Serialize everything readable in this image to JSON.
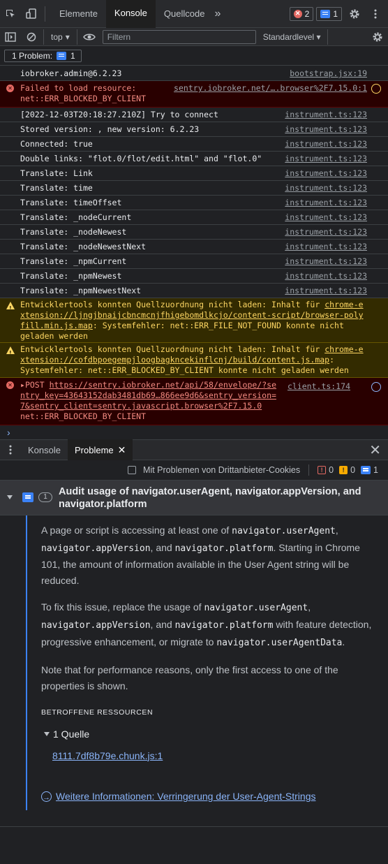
{
  "tabs": {
    "items": [
      {
        "label": "Elemente"
      },
      {
        "label": "Konsole",
        "active": true
      },
      {
        "label": "Quellcode"
      }
    ],
    "more": "»",
    "error_count": "2",
    "issue_count": "1"
  },
  "toolbar": {
    "context": "top",
    "filter_placeholder": "Filtern",
    "level": "Standardlevel"
  },
  "problems_button": {
    "label": "1 Problem:",
    "count": "1"
  },
  "console_rows": [
    {
      "type": "log",
      "text": "iobroker.admin@6.2.23",
      "source": "bootstrap.jsx:19"
    },
    {
      "type": "error",
      "line1": "Failed to load resource:",
      "line2": "net::ERR_BLOCKED_BY_CLIENT",
      "source": "sentry.iobroker.net/….browser%2F7.15.0:1"
    },
    {
      "type": "log",
      "text": "[2022-12-03T20:18:27.210Z] Try to connect",
      "source": "instrument.ts:123"
    },
    {
      "type": "log",
      "text": "Stored version: , new version: 6.2.23",
      "source": "instrument.ts:123"
    },
    {
      "type": "log",
      "text": "Connected: true",
      "source": "instrument.ts:123"
    },
    {
      "type": "log",
      "text": "Double links: \"flot.0/flot/edit.html\" and \"flot.0\"",
      "source": "instrument.ts:123"
    },
    {
      "type": "log",
      "text": "Translate: Link",
      "source": "instrument.ts:123"
    },
    {
      "type": "log",
      "text": "Translate: time",
      "source": "instrument.ts:123"
    },
    {
      "type": "log",
      "text": "Translate: timeOffset",
      "source": "instrument.ts:123"
    },
    {
      "type": "log",
      "text": "Translate: _nodeCurrent",
      "source": "instrument.ts:123"
    },
    {
      "type": "log",
      "text": "Translate: _nodeNewest",
      "source": "instrument.ts:123"
    },
    {
      "type": "log",
      "text": "Translate: _nodeNewestNext",
      "source": "instrument.ts:123"
    },
    {
      "type": "log",
      "text": "Translate: _npmCurrent",
      "source": "instrument.ts:123"
    },
    {
      "type": "log",
      "text": "Translate: _npmNewest",
      "source": "instrument.ts:123"
    },
    {
      "type": "log",
      "text": "Translate: _npmNewestNext",
      "source": "instrument.ts:123"
    }
  ],
  "warnings": [
    {
      "prefix": "Entwicklertools konnten Quellzuordnung nicht laden: Inhalt für ",
      "link_a": "chrome-e",
      "link_b": "xtension://ljngjbnaijcbncmcnjfhigebomdlkcjo/content-script/browser-poly",
      "link_c": "fill.min.js.map",
      "suffix_c": ": Systemfehler: net::ERR_FILE_NOT_FOUND konnte nicht",
      "line4": "geladen werden"
    },
    {
      "prefix": "Entwicklertools konnten Quellzuordnung nicht laden: Inhalt für ",
      "link_a": "chrome-e",
      "link_b": "xtension://cofdbpoegempjloogbagkncekinflcnj/build/content.js.map",
      "suffix_b": ":",
      "line3": "Systemfehler: net::ERR_BLOCKED_BY_CLIENT konnte nicht geladen werden"
    }
  ],
  "post_error": {
    "method": "POST",
    "url1": "https://sentry.iobroker.net/api/58/envelope/?se",
    "url2": "ntry_key=43643152dab3481db69…866ee9d6&sentry_version=",
    "url3": "7&sentry_client=sentry.javascript.browser%2F7.15.0",
    "status": "net::ERR_BLOCKED_BY_CLIENT",
    "source": "client.ts:174"
  },
  "prompt": "›",
  "drawer": {
    "tabs": [
      {
        "label": "Konsole"
      },
      {
        "label": "Probleme",
        "active": true
      }
    ],
    "third_party_label": "Mit Problemen von Drittanbieter-Cookies",
    "error_count": "0",
    "warning_count": "0",
    "info_count": "1"
  },
  "issue": {
    "count": "1",
    "title": "Audit usage of navigator.userAgent, navigator.appVersion, and navigator.platform",
    "p1": {
      "t1": "A page or script is accessing at least one of ",
      "c1": "navigator.userAgent",
      "t2": ", ",
      "c2": "navigator.appVersion",
      "t3": ", and ",
      "c3": "navigator.platform",
      "t4": ". Starting in Chrome 101, the amount of information available in the User Agent string will be reduced."
    },
    "p2": {
      "t1": "To fix this issue, replace the usage of ",
      "c1": "navigator.userAgent",
      "t2": ", ",
      "c2": "navigator.appVersion",
      "t3": ", and ",
      "c3": "navigator.platform",
      "t4": " with feature detection, progressive enhancement, or migrate to ",
      "c4": "navigator.userAgentData",
      "t5": "."
    },
    "p3": "Note that for performance reasons, only the first access to one of the properties is shown.",
    "affected_heading": "BETROFFENE RESSOURCEN",
    "source_toggle": "1 Quelle",
    "resource_link": "8111.7df8b79e.chunk.js:1",
    "more_info": "Weitere Informationen: Verringerung der User-Agent-Strings"
  },
  "colors": {
    "accent": "#3b82f6",
    "error_bg": "#290000",
    "warning_bg": "#332b00",
    "link": "#8ab4f8"
  }
}
